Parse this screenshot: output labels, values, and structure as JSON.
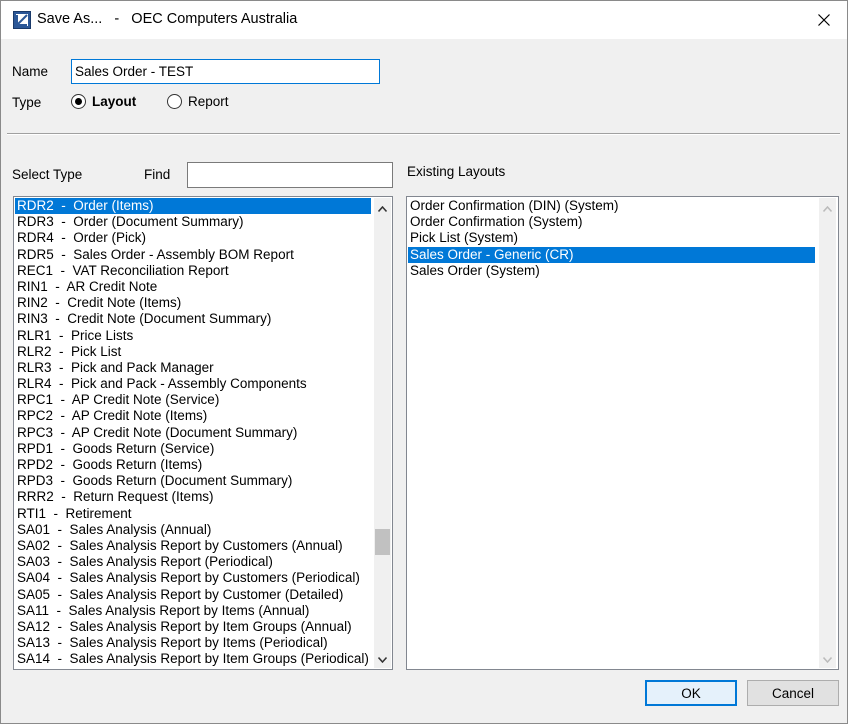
{
  "window": {
    "title": "Save As...   -   OEC Computers Australia"
  },
  "form": {
    "name_label": "Name",
    "name_value": "Sales Order - TEST",
    "type_label": "Type",
    "type_options": [
      {
        "label": "Layout",
        "selected": true
      },
      {
        "label": "Report",
        "selected": false
      }
    ]
  },
  "select_type": {
    "label": "Select Type",
    "find_label": "Find",
    "find_value": "",
    "items": [
      "RDR2  -  Order (Items)",
      "RDR3  -  Order (Document Summary)",
      "RDR4  -  Order (Pick)",
      "RDR5  -  Sales Order - Assembly BOM Report",
      "REC1  -  VAT Reconciliation Report",
      "RIN1  -  AR Credit Note",
      "RIN2  -  Credit Note (Items)",
      "RIN3  -  Credit Note (Document Summary)",
      "RLR1  -  Price Lists",
      "RLR2  -  Pick List",
      "RLR3  -  Pick and Pack Manager",
      "RLR4  -  Pick and Pack - Assembly Components",
      "RPC1  -  AP Credit Note (Service)",
      "RPC2  -  AP Credit Note (Items)",
      "RPC3  -  AP Credit Note (Document Summary)",
      "RPD1  -  Goods Return (Service)",
      "RPD2  -  Goods Return (Items)",
      "RPD3  -  Goods Return (Document Summary)",
      "RRR2  -  Return Request (Items)",
      "RTI1  -  Retirement",
      "SA01  -  Sales Analysis (Annual)",
      "SA02  -  Sales Analysis Report by Customers (Annual)",
      "SA03  -  Sales Analysis Report (Periodical)",
      "SA04  -  Sales Analysis Report by Customers (Periodical)",
      "SA05  -  Sales Analysis Report by Customer (Detailed)",
      "SA11  -  Sales Analysis Report by Items (Annual)",
      "SA12  -  Sales Analysis Report by Item Groups (Annual)",
      "SA13  -  Sales Analysis Report by Items (Periodical)",
      "SA14  -  Sales Analysis Report by Item Groups (Periodical)"
    ],
    "selected_index": 0
  },
  "existing_layouts": {
    "label": "Existing Layouts",
    "items": [
      "Order Confirmation (DIN) (System)",
      "Order Confirmation (System)",
      "Pick List (System)",
      "Sales Order - Generic (CR)",
      "Sales Order (System)"
    ],
    "selected_index": 3
  },
  "buttons": {
    "ok": "OK",
    "cancel": "Cancel"
  },
  "colors": {
    "selection": "#0078d7",
    "focus_border": "#0078d7"
  }
}
